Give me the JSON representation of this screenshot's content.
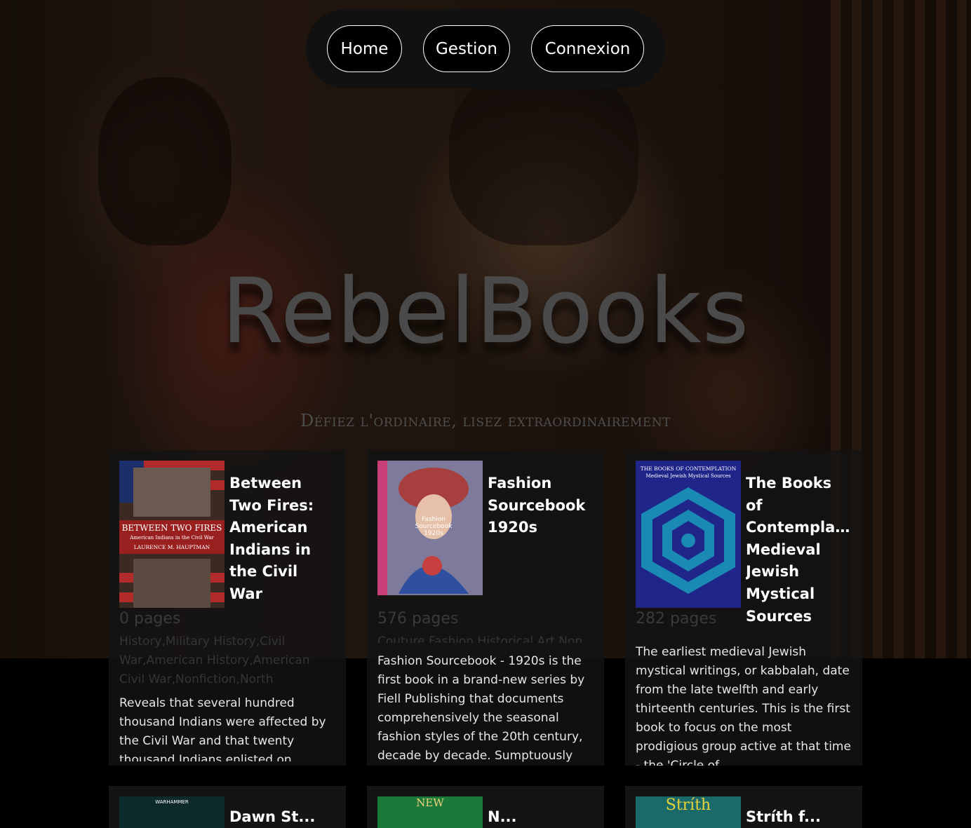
{
  "nav": {
    "home_label": "Home",
    "gestion_label": "Gestion",
    "connexion_label": "Connexion"
  },
  "hero": {
    "brand": "RebelBooks",
    "tagline": "Défiez l'ordinaire, lisez extraordinairement"
  },
  "books": [
    {
      "title": "Between Two Fires: American Indians in the Civil War",
      "pages": "0 pages",
      "categories": "History,Military History,Civil War,American History,American Civil War,Nonfiction,North",
      "description": "Reveals that several hundred thousand Indians were affected by the Civil War and that twenty thousand Indians enlisted on",
      "cover_title": "BETWEEN TWO FIRES",
      "cover_subtitle": "American Indians in the Civil War",
      "cover_author": "LAURENCE M. HAUPTMAN"
    },
    {
      "title": "Fashion Sourcebook 1920s",
      "pages": "576 pages",
      "categories": "Couture,Fashion,Historical,Art,Non",
      "description": "Fashion Sourcebook - 1920s is the first book in a brand-new series by Fiell Publishing that documents comprehensively the seasonal fashion styles of the 20th century, decade by decade. Sumptuously",
      "cover_title": "Fashion Sourcebook 1920s"
    },
    {
      "title": "The Books of Contemplation: Medieval Jewish Mystical Sources",
      "title_display": "The Books of Contemplati... Medieval Jewish Mystical Sources",
      "pages": "282 pages",
      "categories": "",
      "description": "The earliest medieval Jewish mystical writings, or kabbalah, date from the late twelfth and early thirteenth centuries. This is the first book to focus on the most prodigious group active at that time - the 'Circle of",
      "cover_title": "THE BOOKS OF CONTEMPLATION",
      "cover_subtitle": "Medieval Jewish Mystical Sources"
    }
  ],
  "books_row2": [
    {
      "title": "Dawn St...",
      "cover_label": "WARHAMMER"
    },
    {
      "title": "N...",
      "cover_label": "NEW"
    },
    {
      "title": "Stríth f...",
      "cover_label": "Stríth"
    }
  ]
}
